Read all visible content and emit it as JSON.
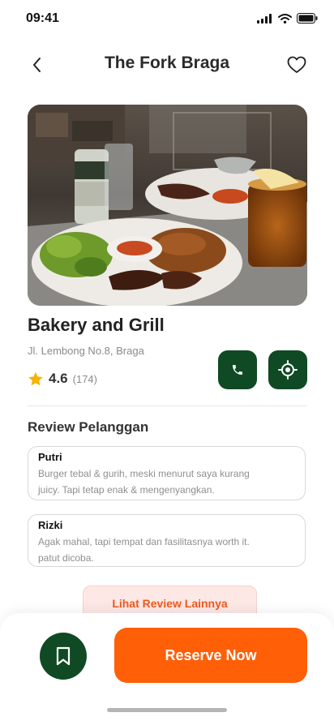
{
  "status": {
    "time": "09:41"
  },
  "header": {
    "title": "The Fork Braga"
  },
  "place": {
    "name": "Bakery and Grill",
    "address": "Jl. Lembong No.8, Braga",
    "rating": "4.6",
    "rating_count": "(174)"
  },
  "reviews": {
    "title": "Review Pelanggan",
    "items": [
      {
        "name": "Putri",
        "text_line1": "Burger tebal & gurih, meski menurut saya kurang",
        "text_line2": "juicy. Tapi tetap enak & mengenyangkan."
      },
      {
        "name": "Rizki",
        "text_line1": "Agak mahal, tapi tempat dan fasilitasnya worth it.",
        "text_line2": "patut dicoba."
      }
    ],
    "more_label": "Lihat Review Lainnya"
  },
  "actions": {
    "reserve_label": "Reserve Now"
  },
  "icons": {
    "back": "chevron-left-icon",
    "favorite": "heart-icon",
    "call": "phone-icon",
    "location": "location-target-icon",
    "bookmark": "bookmark-icon",
    "star": "star-icon"
  },
  "colors": {
    "primary_green": "#0f4a24",
    "accent_orange": "#ff5f07",
    "star_yellow": "#f5b400"
  }
}
